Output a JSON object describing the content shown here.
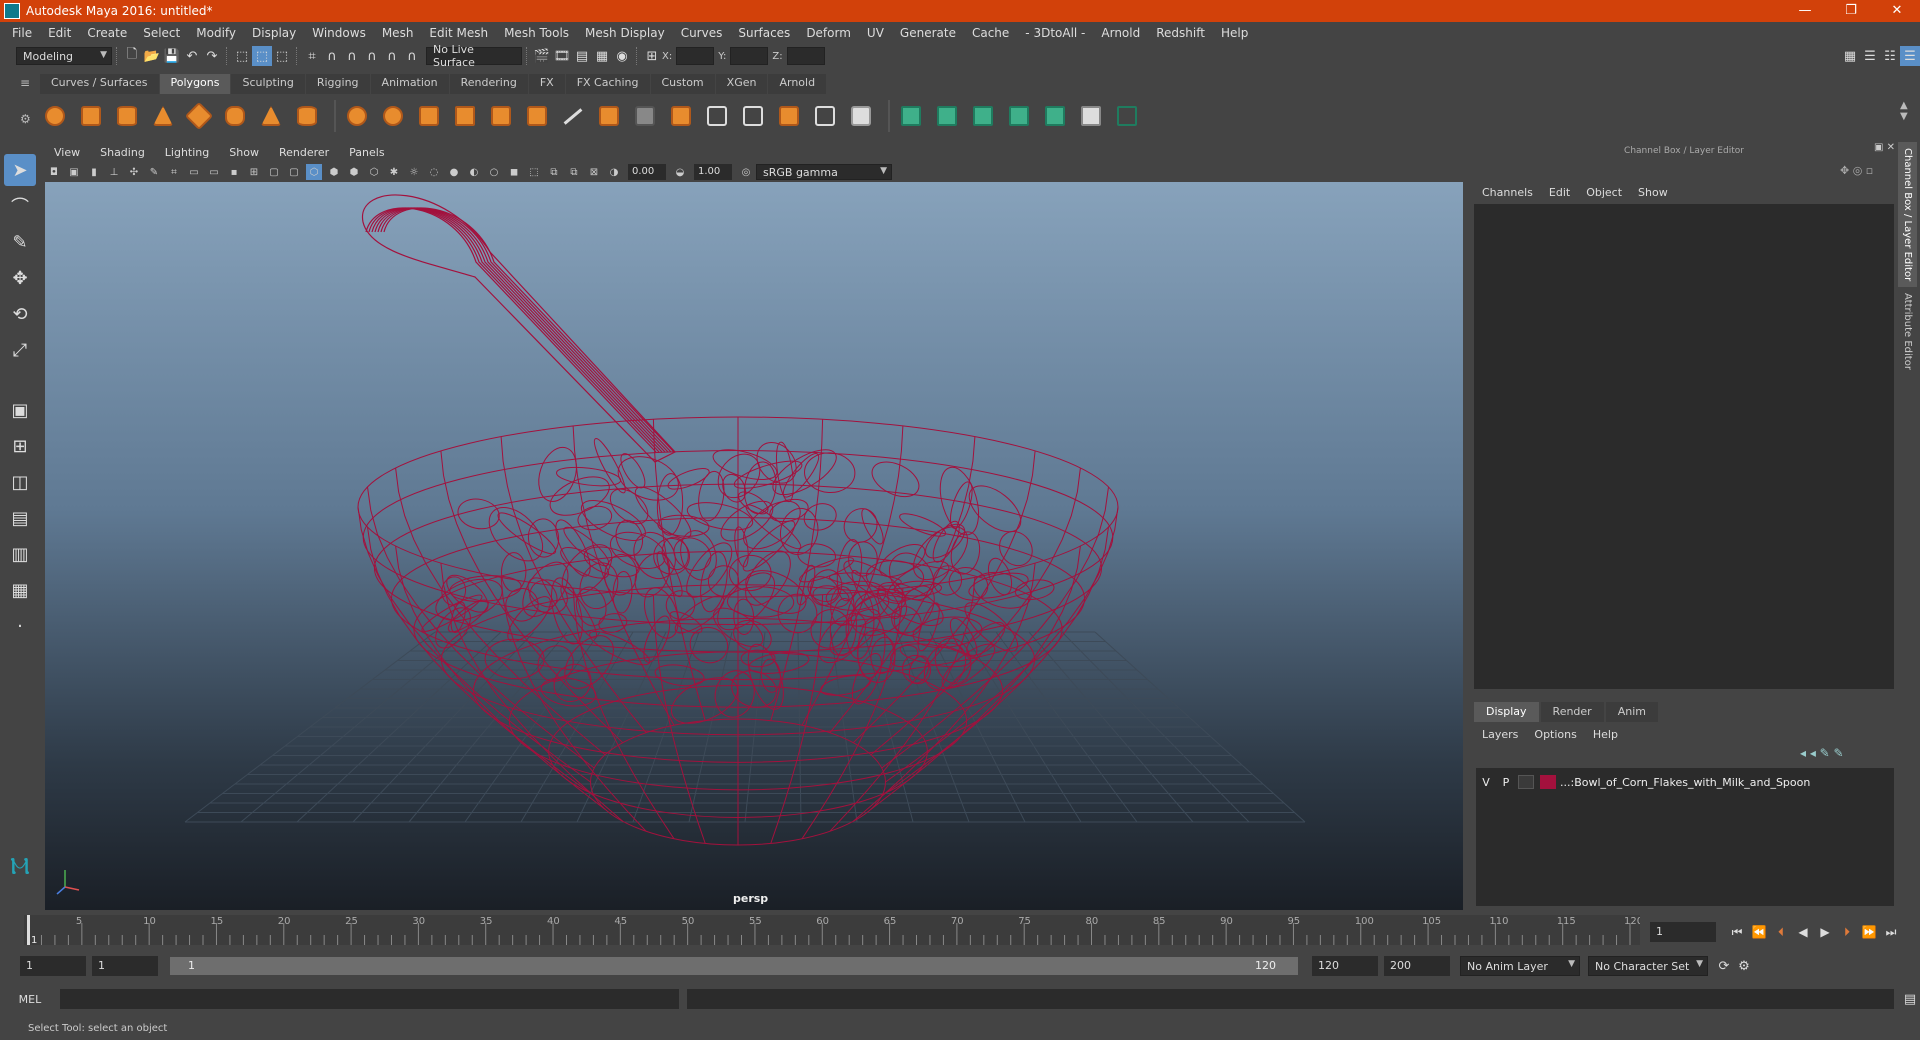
{
  "window": {
    "title": "Autodesk Maya 2016: untitled*"
  },
  "menubar": [
    "File",
    "Edit",
    "Create",
    "Select",
    "Modify",
    "Display",
    "Windows",
    "Mesh",
    "Edit Mesh",
    "Mesh Tools",
    "Mesh Display",
    "Curves",
    "Surfaces",
    "Deform",
    "UV",
    "Generate",
    "Cache",
    "- 3DtoAll -",
    "Arnold",
    "Redshift",
    "Help"
  ],
  "statusline": {
    "mode": "Modeling",
    "live_surface": "No Live Surface",
    "x_label": "X:",
    "y_label": "Y:",
    "z_label": "Z:"
  },
  "shelf": {
    "tabs": [
      "Curves / Surfaces",
      "Polygons",
      "Sculpting",
      "Rigging",
      "Animation",
      "Rendering",
      "FX",
      "FX Caching",
      "Custom",
      "XGen",
      "Arnold"
    ],
    "active": "Polygons"
  },
  "viewport": {
    "menu": [
      "View",
      "Shading",
      "Lighting",
      "Show",
      "Renderer",
      "Panels"
    ],
    "exposure": "0.00",
    "gamma": "1.00",
    "colorspace": "sRGB gamma",
    "camera": "persp",
    "wire_color": "#a3113d"
  },
  "channelbox": {
    "header": "Channel Box / Layer Editor",
    "menu": [
      "Channels",
      "Edit",
      "Object",
      "Show"
    ]
  },
  "layers": {
    "tabs": [
      "Display",
      "Render",
      "Anim"
    ],
    "active": "Display",
    "menu": [
      "Layers",
      "Options",
      "Help"
    ],
    "rows": [
      {
        "v": "V",
        "p": "P",
        "name": "...:Bowl_of_Corn_Flakes_with_Milk_and_Spoon",
        "color": "#a3113d"
      }
    ]
  },
  "sidetabs": [
    "Channel Box / Layer Editor",
    "Attribute Editor"
  ],
  "timeline": {
    "ticks": [
      "5",
      "10",
      "15",
      "20",
      "25",
      "30",
      "35",
      "40",
      "45",
      "50",
      "55",
      "60",
      "65",
      "70",
      "75",
      "80",
      "85",
      "90",
      "95",
      "100",
      "105",
      "110",
      "115",
      "120"
    ],
    "start_marker": "1",
    "current_frame": "1"
  },
  "range": {
    "start": "1",
    "playback_start": "1",
    "slider_start": "1",
    "slider_end": "120",
    "playback_end": "120",
    "end": "200",
    "anim_layer": "No Anim Layer",
    "character_set": "No Character Set"
  },
  "cmdline": {
    "label": "MEL"
  },
  "helpline": {
    "text": "Select Tool: select an object"
  }
}
